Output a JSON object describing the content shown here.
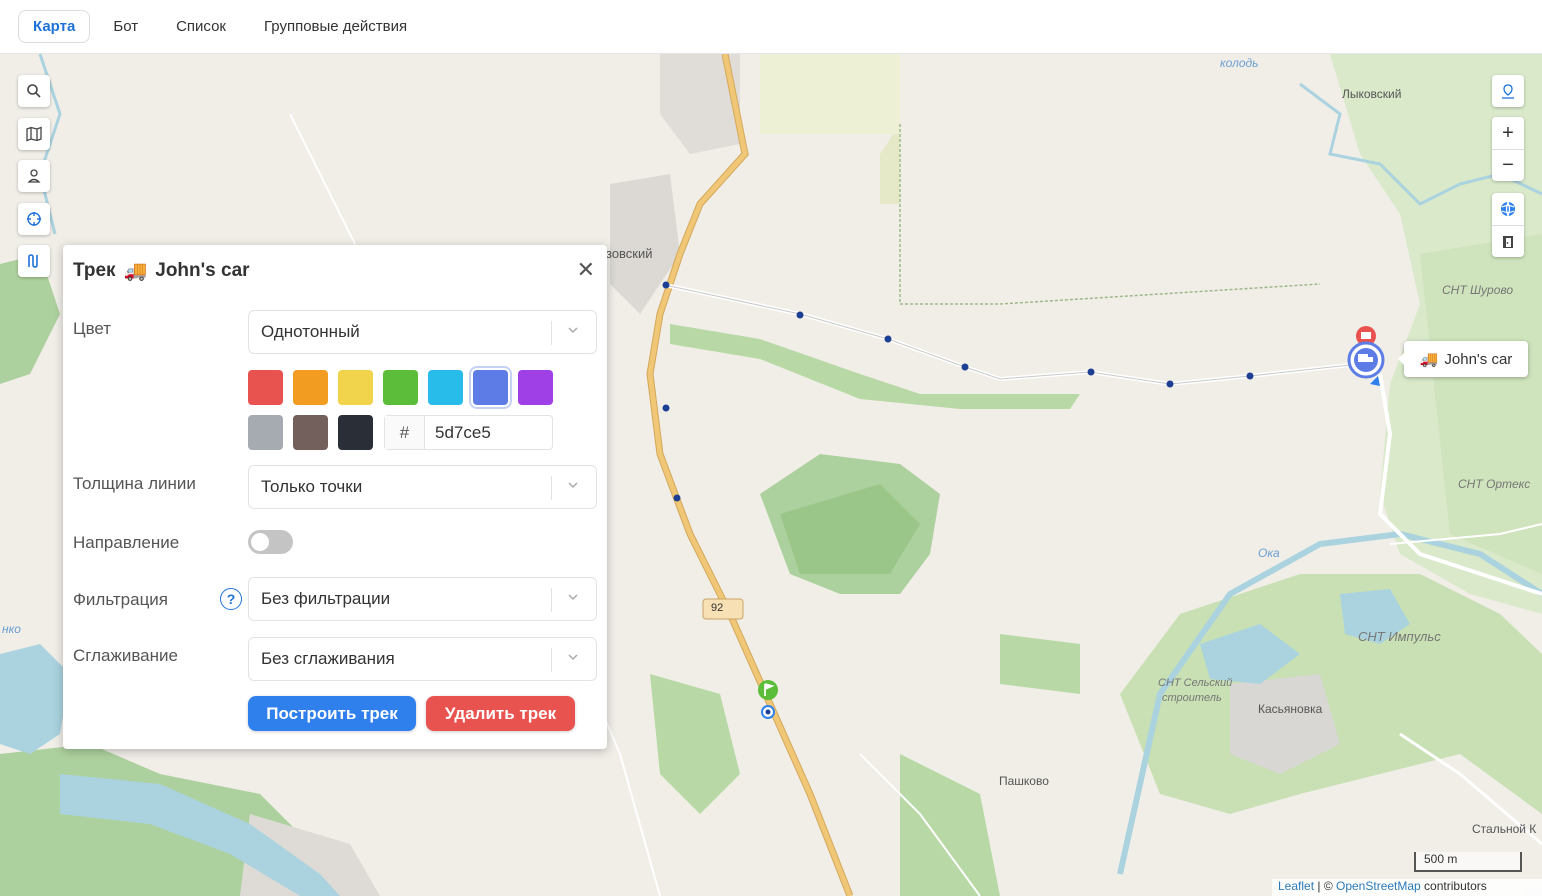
{
  "nav": {
    "tabs": [
      {
        "label": "Карта",
        "active": true
      },
      {
        "label": "Бот"
      },
      {
        "label": "Список"
      },
      {
        "label": "Групповые действия"
      }
    ]
  },
  "map": {
    "labels": {
      "lykovsky": "Лыковский",
      "snt_shurovo": "СНТ Шурово",
      "snt_ortmeks": "СНТ Ортекс",
      "oka": "Ока",
      "snt_impuls": "СНТ Импульс",
      "snt_selsky_1": "СНТ Сельский",
      "snt_selsky_2": "строитель",
      "kasyanovka": "Касьяновка",
      "pashkovo": "Пашково",
      "stalnoy": "Стальной К",
      "ozovsky": "зовский",
      "river_top": "колодь",
      "river_left": "нко",
      "road_badge": "92"
    },
    "scale_label": "500 m",
    "attribution": {
      "leaflet": "Leaflet",
      "sep": " | © ",
      "osm": "OpenStreetMap",
      "rest": " contributors"
    },
    "car_label": "John's car",
    "car_emoji": "🚚",
    "accent_track": "#1c3f94",
    "road_color": "#f0c777"
  },
  "panel": {
    "title_prefix": "Трек",
    "title_emoji": "🚚",
    "title_name": "John's car",
    "color_label": "Цвет",
    "color_mode": "Однотонный",
    "swatches": [
      "#e9534f",
      "#f29d22",
      "#f1d44c",
      "#5bbd39",
      "#27bce9",
      "#5d7ce5",
      "#9f3fe6",
      "#a6abb1",
      "#735f5b",
      "#2a2f37"
    ],
    "selected_swatch": "#5d7ce5",
    "hex_hash": "#",
    "hex_value": "5d7ce5",
    "thickness_label": "Толщина линии",
    "thickness_value": "Только точки",
    "direction_label": "Направление",
    "direction_on": false,
    "filter_label": "Фильтрация",
    "filter_value": "Без фильтрации",
    "smoothing_label": "Сглаживание",
    "smoothing_value": "Без сглаживания",
    "build_button": "Построить трек",
    "delete_button": "Удалить трек"
  }
}
